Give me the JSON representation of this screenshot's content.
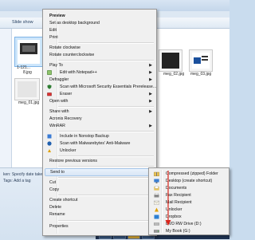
{
  "explorer": {
    "toolbar": {
      "slideshow_label": "Slide show"
    },
    "selected_file": {
      "name_line1": "1-121...",
      "name_line2": "8.jpg"
    },
    "files": [
      {
        "name": "meg_02.jpg"
      },
      {
        "name": "meg_03.jpg"
      },
      {
        "name": "meg_01.jpg"
      }
    ],
    "details": {
      "line1": "ken: Specify date take",
      "line2": "Tags: Add a tag"
    }
  },
  "context_menu": {
    "items": [
      {
        "label": "Preview",
        "bold": true
      },
      {
        "label": "Set as desktop background"
      },
      {
        "label": "Edit"
      },
      {
        "label": "Print"
      },
      {
        "label": "Rotate clockwise"
      },
      {
        "label": "Rotate counterclockwise"
      },
      {
        "label": "Play To",
        "arrow": "▶"
      },
      {
        "label": "Edit with Notepad++",
        "arrow": "▶"
      },
      {
        "label": "Defraggler",
        "arrow": "▶"
      },
      {
        "label": "Scan with Microsoft Security Essentials Prerelease..."
      },
      {
        "label": "Eraser",
        "arrow": "▶"
      },
      {
        "label": "Open with",
        "arrow": "▶"
      },
      {
        "label": "Share with",
        "arrow": "▶"
      },
      {
        "label": "Acronis Recovery"
      },
      {
        "label": "WinRAR",
        "arrow": "▶"
      },
      {
        "label": "Include in Nonstop Backup"
      },
      {
        "label": "Scan with Malwarebytes' Anti-Malware"
      },
      {
        "label": "Unlocker"
      },
      {
        "label": "Restore previous versions"
      },
      {
        "label": "Send to",
        "arrow": "▶"
      },
      {
        "label": "Cut"
      },
      {
        "label": "Copy"
      },
      {
        "label": "Create shortcut"
      },
      {
        "label": "Delete"
      },
      {
        "label": "Rename"
      },
      {
        "label": "Properties"
      }
    ]
  },
  "send_to_menu": {
    "items": [
      {
        "label": "Compressed (zipped) Folder"
      },
      {
        "label": "Desktop (create shortcut)"
      },
      {
        "label": "Documents"
      },
      {
        "label": "Fax Recipient"
      },
      {
        "label": "Mail Recipient"
      },
      {
        "label": "Unlocker"
      },
      {
        "label": "Dropbox"
      },
      {
        "label": "DVD RW Drive (D:)"
      },
      {
        "label": "My Book (G:)"
      }
    ]
  },
  "colors": {
    "highlight_border": "#a8c8eb",
    "annotation_arrow": "#d9261c"
  }
}
